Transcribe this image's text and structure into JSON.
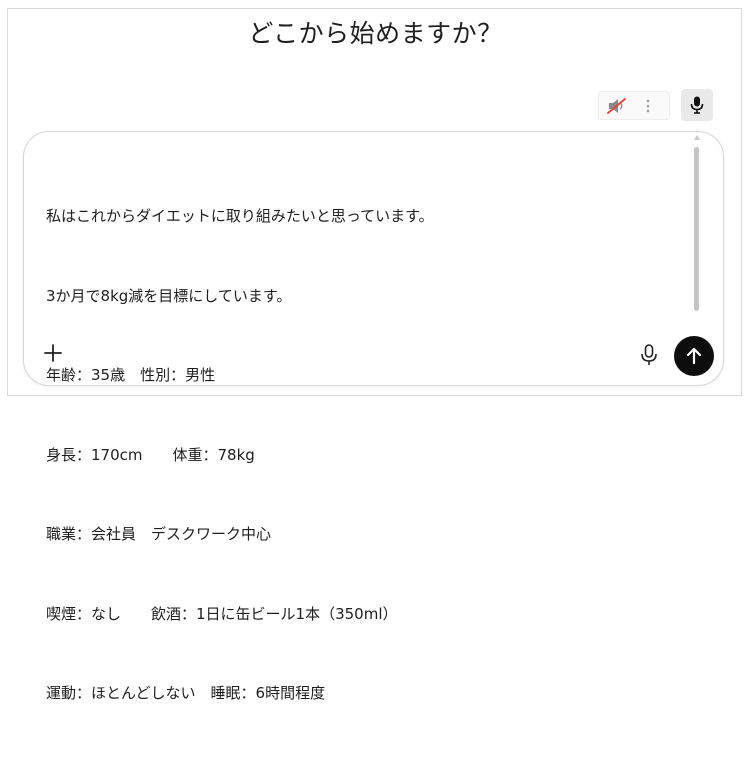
{
  "heading": "どこから始めますか？",
  "composer": {
    "lines": [
      "私はこれからダイエットに取り組みたいと思っています。",
      "3か月で8kg減を目標にしています。",
      "年齢：35歳　性別：男性",
      "身長：170cm　　体重：78kg",
      "職業：会社員　デスクワーク中心",
      "喫煙：なし　　飲酒：1日に缶ビール1本（350ml）",
      "運動：ほとんどしない　睡眠：6時間程度"
    ]
  },
  "icons": {
    "mute": "speaker-muted-icon",
    "more": "more-vertical-icon",
    "mic": "microphone-icon",
    "attach": "plus-icon",
    "send": "arrow-up-icon"
  },
  "colors": {
    "send_button": "#0d0d0d",
    "mute_slash": "#e0443a",
    "border": "#d7d7d7"
  }
}
